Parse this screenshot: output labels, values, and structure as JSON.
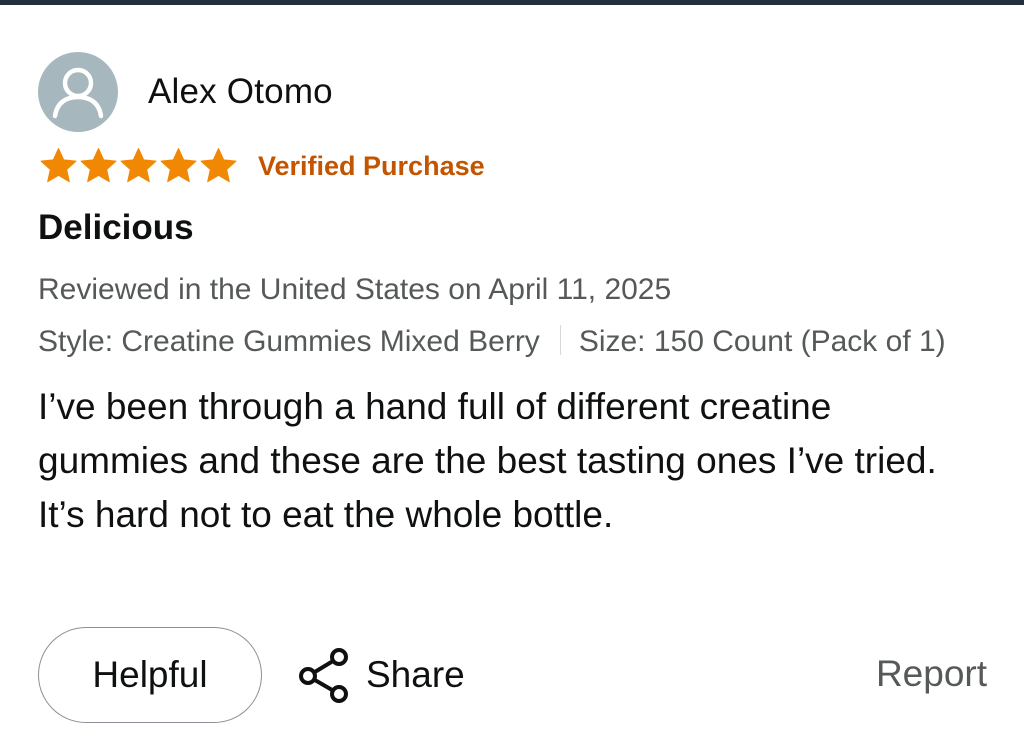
{
  "review": {
    "author": "Alex Otomo",
    "rating": 5,
    "rating_max": 5,
    "verified_label": "Verified Purchase",
    "title": "Delicious",
    "meta": "Reviewed in the United States on April 11, 2025",
    "style": "Style: Creatine Gummies Mixed Berry",
    "size": "Size: 150 Count (Pack of 1)",
    "body": "I’ve been through a hand full of different creatine gummies and these are the best tasting ones I’ve tried. It’s hard not to eat the whole bottle."
  },
  "actions": {
    "helpful_label": "Helpful",
    "share_label": "Share",
    "report_label": "Report"
  },
  "colors": {
    "star": "#f08804",
    "verified": "#c45500",
    "meta": "#565959",
    "avatar_bg": "#a6b7bd",
    "top_border": "#232f3e"
  },
  "icons": {
    "avatar": "user-avatar-icon",
    "star": "star-icon",
    "share": "share-icon"
  }
}
